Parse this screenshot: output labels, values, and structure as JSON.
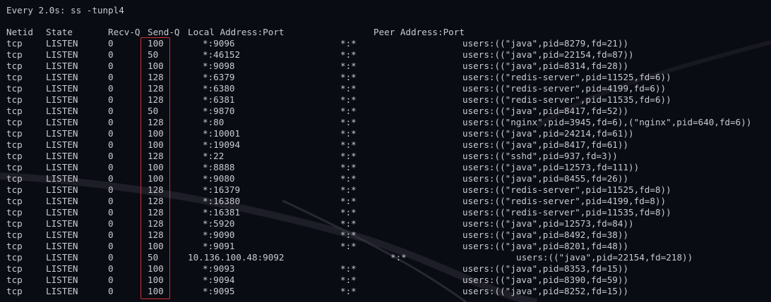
{
  "watch_header": "Every 2.0s: ss -tunpl4",
  "columns": {
    "netid": "Netid",
    "state": "State",
    "recv_q": "Recv-Q",
    "send_q": "Send-Q",
    "local": "Local Address:Port",
    "peer": "Peer Address:Port"
  },
  "highlight_color": "#d03030",
  "rows": [
    {
      "netid": "tcp",
      "state": "LISTEN",
      "recv_q": "0",
      "send_q": "100",
      "local": "*:9096",
      "peer": "*:*",
      "process": "users:((\"java\",pid=8279,fd=21))"
    },
    {
      "netid": "tcp",
      "state": "LISTEN",
      "recv_q": "0",
      "send_q": "50",
      "local": "*:46152",
      "peer": "*:*",
      "process": "users:((\"java\",pid=22154,fd=87))"
    },
    {
      "netid": "tcp",
      "state": "LISTEN",
      "recv_q": "0",
      "send_q": "100",
      "local": "*:9098",
      "peer": "*:*",
      "process": "users:((\"java\",pid=8314,fd=28))"
    },
    {
      "netid": "tcp",
      "state": "LISTEN",
      "recv_q": "0",
      "send_q": "128",
      "local": "*:6379",
      "peer": "*:*",
      "process": "users:((\"redis-server\",pid=11525,fd=6))"
    },
    {
      "netid": "tcp",
      "state": "LISTEN",
      "recv_q": "0",
      "send_q": "128",
      "local": "*:6380",
      "peer": "*:*",
      "process": "users:((\"redis-server\",pid=4199,fd=6))"
    },
    {
      "netid": "tcp",
      "state": "LISTEN",
      "recv_q": "0",
      "send_q": "128",
      "local": "*:6381",
      "peer": "*:*",
      "process": "users:((\"redis-server\",pid=11535,fd=6))"
    },
    {
      "netid": "tcp",
      "state": "LISTEN",
      "recv_q": "0",
      "send_q": "50",
      "local": "*:9870",
      "peer": "*:*",
      "process": "users:((\"java\",pid=8417,fd=52))"
    },
    {
      "netid": "tcp",
      "state": "LISTEN",
      "recv_q": "0",
      "send_q": "128",
      "local": "*:80",
      "peer": "*:*",
      "process": "users:((\"nginx\",pid=3945,fd=6),(\"nginx\",pid=640,fd=6))"
    },
    {
      "netid": "tcp",
      "state": "LISTEN",
      "recv_q": "0",
      "send_q": "100",
      "local": "*:10001",
      "peer": "*:*",
      "process": "users:((\"java\",pid=24214,fd=61))"
    },
    {
      "netid": "tcp",
      "state": "LISTEN",
      "recv_q": "0",
      "send_q": "100",
      "local": "*:19094",
      "peer": "*:*",
      "process": "users:((\"java\",pid=8417,fd=61))"
    },
    {
      "netid": "tcp",
      "state": "LISTEN",
      "recv_q": "0",
      "send_q": "128",
      "local": "*:22",
      "peer": "*:*",
      "process": "users:((\"sshd\",pid=937,fd=3))"
    },
    {
      "netid": "tcp",
      "state": "LISTEN",
      "recv_q": "0",
      "send_q": "100",
      "local": "*:8888",
      "peer": "*:*",
      "process": "users:((\"java\",pid=12573,fd=111))"
    },
    {
      "netid": "tcp",
      "state": "LISTEN",
      "recv_q": "0",
      "send_q": "100",
      "local": "*:9080",
      "peer": "*:*",
      "process": "users:((\"java\",pid=8455,fd=26))"
    },
    {
      "netid": "tcp",
      "state": "LISTEN",
      "recv_q": "0",
      "send_q": "128",
      "local": "*:16379",
      "peer": "*:*",
      "process": "users:((\"redis-server\",pid=11525,fd=8))"
    },
    {
      "netid": "tcp",
      "state": "LISTEN",
      "recv_q": "0",
      "send_q": "128",
      "local": "*:16380",
      "peer": "*:*",
      "process": "users:((\"redis-server\",pid=4199,fd=8))"
    },
    {
      "netid": "tcp",
      "state": "LISTEN",
      "recv_q": "0",
      "send_q": "128",
      "local": "*:16381",
      "peer": "*:*",
      "process": "users:((\"redis-server\",pid=11535,fd=8))"
    },
    {
      "netid": "tcp",
      "state": "LISTEN",
      "recv_q": "0",
      "send_q": "128",
      "local": "*:5920",
      "peer": "*:*",
      "process": "users:((\"java\",pid=12573,fd=84))"
    },
    {
      "netid": "tcp",
      "state": "LISTEN",
      "recv_q": "0",
      "send_q": "128",
      "local": "*:9090",
      "peer": "*:*",
      "process": "users:((\"java\",pid=8492,fd=38))"
    },
    {
      "netid": "tcp",
      "state": "LISTEN",
      "recv_q": "0",
      "send_q": "100",
      "local": "*:9091",
      "peer": "*:*",
      "process": "users:((\"java\",pid=8201,fd=48))"
    },
    {
      "netid": "tcp",
      "state": "LISTEN",
      "recv_q": "0",
      "send_q": "50",
      "local": "10.136.100.48:9092",
      "peer": "*:*",
      "process": "users:((\"java\",pid=22154,fd=218))",
      "wide": true
    },
    {
      "netid": "tcp",
      "state": "LISTEN",
      "recv_q": "0",
      "send_q": "100",
      "local": "*:9093",
      "peer": "*:*",
      "process": "users:((\"java\",pid=8353,fd=15))"
    },
    {
      "netid": "tcp",
      "state": "LISTEN",
      "recv_q": "0",
      "send_q": "100",
      "local": "*:9094",
      "peer": "*:*",
      "process": "users:((\"java\",pid=8390,fd=59))"
    },
    {
      "netid": "tcp",
      "state": "LISTEN",
      "recv_q": "0",
      "send_q": "100",
      "local": "*:9095",
      "peer": "*:*",
      "process": "users:((\"java\",pid=8252,fd=15))"
    }
  ]
}
